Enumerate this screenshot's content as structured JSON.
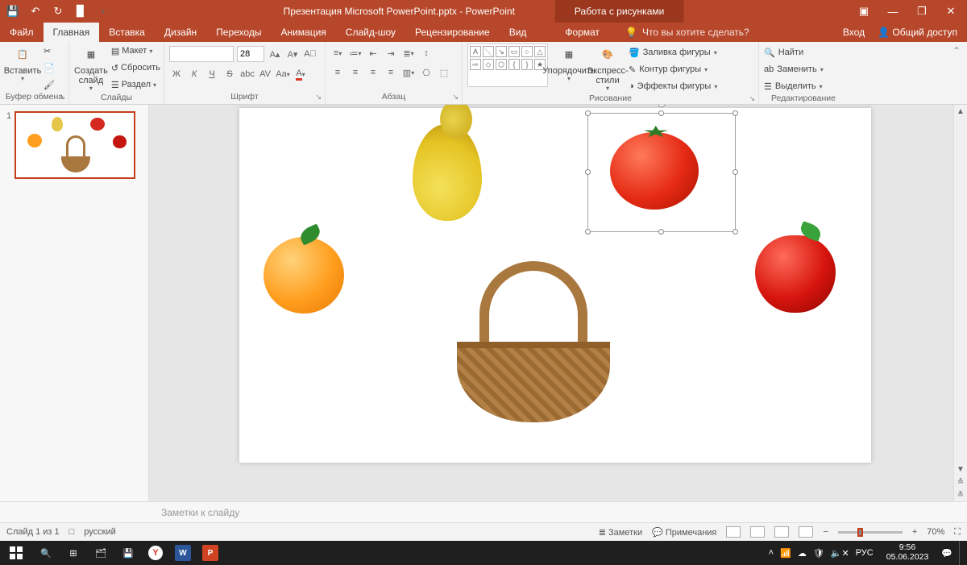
{
  "titlebar": {
    "doc_title": "Презентация Microsoft PowerPoint.pptx - PowerPoint",
    "contextual_title": "Работа с рисунками"
  },
  "tabs": {
    "file": "Файл",
    "home": "Главная",
    "insert": "Вставка",
    "design": "Дизайн",
    "transitions": "Переходы",
    "animations": "Анимация",
    "slideshow": "Слайд-шоу",
    "review": "Рецензирование",
    "view": "Вид",
    "format": "Формат",
    "tellme_placeholder": "Что вы хотите сделать?",
    "signin": "Вход",
    "share": "Общий доступ"
  },
  "ribbon": {
    "clipboard": {
      "label": "Буфер обмена",
      "paste": "Вставить"
    },
    "slides": {
      "label": "Слайды",
      "new_slide": "Создать\nслайд",
      "layout": "Макет",
      "reset": "Сбросить",
      "section": "Раздел"
    },
    "font": {
      "label": "Шрифт",
      "size": "28",
      "bold": "Ж",
      "italic": "К",
      "underline": "Ч",
      "strike": "S",
      "spacing": "abc"
    },
    "paragraph": {
      "label": "Абзац"
    },
    "drawing": {
      "label": "Рисование",
      "arrange": "Упорядочить",
      "quick_styles": "Экспресс-\nстили",
      "fill": "Заливка фигуры",
      "outline": "Контур фигуры",
      "effects": "Эффекты фигуры"
    },
    "editing": {
      "label": "Редактирование",
      "find": "Найти",
      "replace": "Заменить",
      "select": "Выделить"
    }
  },
  "thumbs": {
    "n1": "1"
  },
  "notes": {
    "placeholder": "Заметки к слайду"
  },
  "status": {
    "slide_info": "Слайд 1 из 1",
    "language": "русский",
    "notes_btn": "Заметки",
    "comments_btn": "Примечания",
    "zoom": "70%"
  },
  "taskbar": {
    "lang": "РУС",
    "time": "9:56",
    "date": "05.06.2023"
  },
  "slide_objects": {
    "orange": "orange",
    "pear": "pear",
    "tomato": "tomato (selected)",
    "apple": "apple",
    "basket": "basket"
  }
}
